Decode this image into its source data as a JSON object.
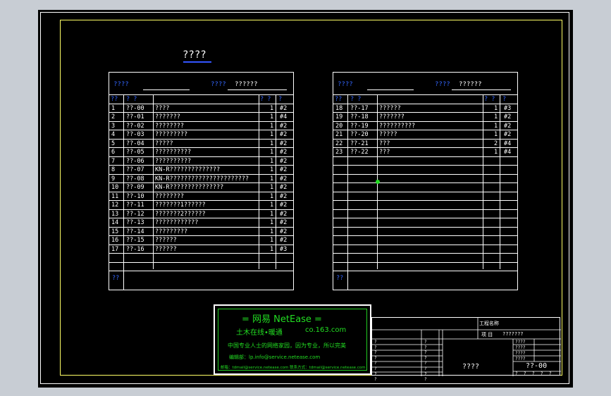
{
  "page_title": "????",
  "left_table": {
    "header_label_1": "????",
    "header_label_2": "????",
    "header_value_2": "??????",
    "col_no": "??",
    "col_code": "? ?",
    "col_count": "? ?",
    "col_size": "?",
    "rows": [
      {
        "no": "1",
        "code": "??-00",
        "name": "????",
        "count": "1",
        "size": "#2"
      },
      {
        "no": "2",
        "code": "??-01",
        "name": "???????",
        "count": "1",
        "size": "#4"
      },
      {
        "no": "3",
        "code": "??-02",
        "name": "????????",
        "count": "1",
        "size": "#2"
      },
      {
        "no": "4",
        "code": "??-03",
        "name": "?????????",
        "count": "1",
        "size": "#2"
      },
      {
        "no": "5",
        "code": "??-04",
        "name": "?????",
        "count": "1",
        "size": "#2"
      },
      {
        "no": "6",
        "code": "??-05",
        "name": "??????????",
        "count": "1",
        "size": "#2"
      },
      {
        "no": "7",
        "code": "??-06",
        "name": "??????????",
        "count": "1",
        "size": "#2"
      },
      {
        "no": "8",
        "code": "??-07",
        "name": "KN-R??????????????",
        "count": "1",
        "size": "#2"
      },
      {
        "no": "9",
        "code": "??-08",
        "name": "KN-R??????????????????????",
        "count": "1",
        "size": "#2"
      },
      {
        "no": "10",
        "code": "??-09",
        "name": "KN-R???????????????",
        "count": "1",
        "size": "#2"
      },
      {
        "no": "11",
        "code": "??-10",
        "name": "????????",
        "count": "1",
        "size": "#2"
      },
      {
        "no": "12",
        "code": "??-11",
        "name": "???????1??????",
        "count": "1",
        "size": "#2"
      },
      {
        "no": "13",
        "code": "??-12",
        "name": "???????2??????",
        "count": "1",
        "size": "#2"
      },
      {
        "no": "14",
        "code": "??-13",
        "name": "????????????",
        "count": "1",
        "size": "#2"
      },
      {
        "no": "15",
        "code": "??-14",
        "name": "?????????",
        "count": "1",
        "size": "#2"
      },
      {
        "no": "16",
        "code": "??-15",
        "name": "??????",
        "count": "1",
        "size": "#2"
      },
      {
        "no": "17",
        "code": "??-16",
        "name": "??????",
        "count": "1",
        "size": "#3"
      }
    ],
    "footer_label": "??"
  },
  "right_table": {
    "header_label_1": "????",
    "header_label_2": "????",
    "header_value_2": "??????",
    "col_no": "??",
    "col_code": "? ?",
    "col_count": "? ?",
    "col_size": "?",
    "rows": [
      {
        "no": "18",
        "code": "??-17",
        "name": "??????",
        "count": "1",
        "size": "#3"
      },
      {
        "no": "19",
        "code": "??-18",
        "name": "???????",
        "count": "1",
        "size": "#2"
      },
      {
        "no": "20",
        "code": "??-19",
        "name": "??????????",
        "count": "1",
        "size": "#2"
      },
      {
        "no": "21",
        "code": "??-20",
        "name": "?????",
        "count": "1",
        "size": "#2"
      },
      {
        "no": "22",
        "code": "??-21",
        "name": "???",
        "count": "2",
        "size": "#4"
      },
      {
        "no": "23",
        "code": "??-22",
        "name": "???",
        "count": "1",
        "size": "#4"
      }
    ],
    "footer_label": "??"
  },
  "stamp": {
    "line1": "=  网易 NetEase  =",
    "line2_left": "土木在线•暖通",
    "line2_right": "co.163.com",
    "line3": "中国专业人士的网络家园，因为专业，所以完美",
    "line4": "编辑部：lp.info@service.netease.com",
    "line5": "邮箱：tdmail@service.netease.com  联系方式：tdmail@service.netease.com"
  },
  "title_block": {
    "project_label": "工程名称",
    "item_label": "项  目",
    "item_value": "???????",
    "drawing_title": "????",
    "drawing_number": "??-00",
    "left_labels": [
      "?",
      "?",
      "?",
      "?",
      "?",
      "?",
      "?",
      "?"
    ],
    "right_labels": [
      "????",
      "????",
      "????",
      "????"
    ],
    "bottom_labels": [
      "?",
      "?",
      "?",
      "?",
      "?"
    ]
  }
}
